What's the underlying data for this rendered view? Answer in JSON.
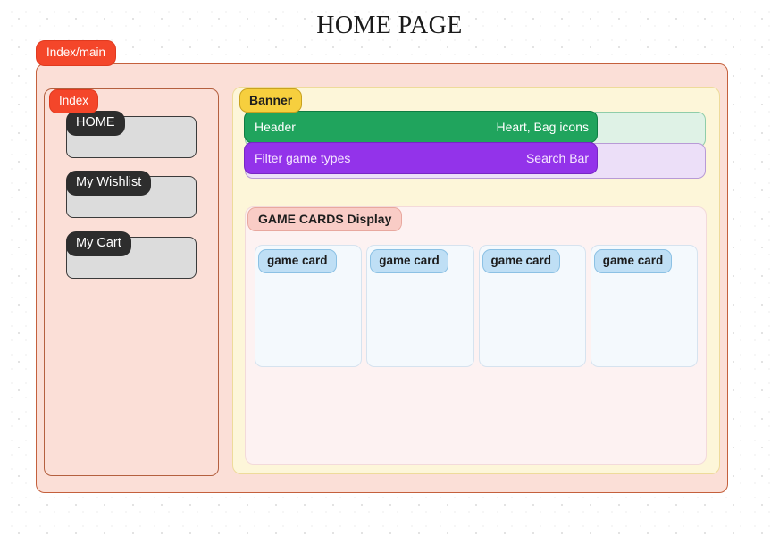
{
  "page": {
    "title": "HOME PAGE"
  },
  "main_frame": {
    "tag": "Index/main"
  },
  "sidebar": {
    "tag": "Index",
    "items": [
      {
        "label": "HOME"
      },
      {
        "label": "My Wishlist"
      },
      {
        "label": "My Cart"
      }
    ]
  },
  "banner": {
    "tag": "Banner",
    "rows": [
      {
        "left_label": "Header",
        "right_label": "Heart, Bag icons"
      },
      {
        "left_label": "Filter game types",
        "right_label": "Search Bar"
      }
    ]
  },
  "game_cards_section": {
    "tag": "GAME CARDS Display",
    "cards": [
      {
        "label": "game card"
      },
      {
        "label": "game card"
      },
      {
        "label": "game card"
      },
      {
        "label": "game card"
      }
    ]
  },
  "colors": {
    "accent_red": "#f4462a",
    "banner_yellow": "#f6cf3e",
    "header_green": "#20a45d",
    "filter_purple": "#9333ea",
    "card_blue": "#bfdff5",
    "section_pink": "#f9ccc6",
    "frame_pink": "#fbdfd7",
    "nav_gray": "#dcdcdc",
    "nav_label_dark": "#2d2d2d"
  }
}
